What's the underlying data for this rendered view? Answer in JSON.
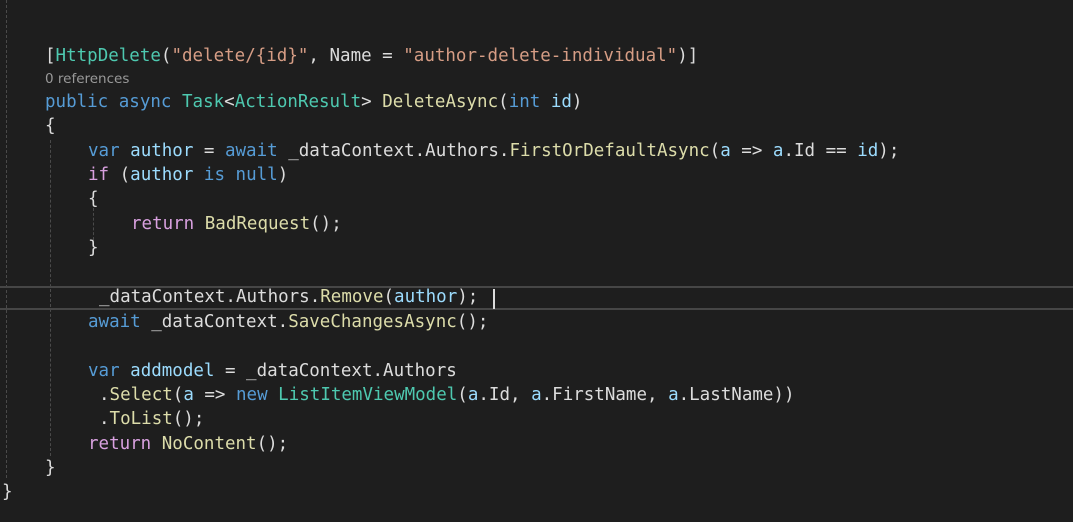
{
  "codelens": {
    "references": "0 references"
  },
  "code": {
    "l1": {
      "open": "[",
      "attr": "HttpDelete",
      "paren_open": "(",
      "route": "\"delete/{id}\"",
      "comma": ", Name = ",
      "name": "\"author-delete-individual\"",
      "close": ")]"
    },
    "l2": {
      "public": "public",
      "async": "async",
      "task": "Task",
      "lt": "<",
      "action_result": "ActionResult",
      "gt": ">",
      "method": "DeleteAsync",
      "p_open": "(",
      "int": "int",
      "id": "id",
      "p_close": ")"
    },
    "l3": {
      "brace": "{"
    },
    "l4": {
      "var": "var",
      "author": "author",
      "eq": " = ",
      "await": "await",
      "ctx": " _dataContext.Authors.",
      "method": "FirstOrDefaultAsync",
      "p_open": "(",
      "a1": "a",
      "arrow": " => ",
      "a2": "a",
      "member": ".Id == ",
      "id": "id",
      "end": ");"
    },
    "l5": {
      "if": "if",
      "p_open": " (",
      "author": "author",
      "is": "is",
      "null": "null",
      "p_close": ")"
    },
    "l6": {
      "brace": "{"
    },
    "l7": {
      "return": "return",
      "method": "BadRequest",
      "end": "();"
    },
    "l8": {
      "brace": "}"
    },
    "l9": {
      "ctx": "_dataContext.Authors.",
      "method": "Remove",
      "p_open": "(",
      "author": "author",
      "end": ");"
    },
    "l10": {
      "await": "await",
      "ctx": " _dataContext.",
      "method": "SaveChangesAsync",
      "end": "();"
    },
    "l11": {
      "var": "var",
      "name": "addmodel",
      "rest": " = _dataContext.Authors"
    },
    "l12": {
      "dot": ".",
      "method": "Select",
      "p_open": "(",
      "a1": "a",
      "arrow": " => ",
      "new": "new",
      "type": "ListItemViewModel",
      "p2_open": "(",
      "a2": "a",
      "m1": ".Id, ",
      "a3": "a",
      "m2": ".FirstName, ",
      "a4": "a",
      "m3": ".LastName))"
    },
    "l13": {
      "dot": ".",
      "method": "ToList",
      "end": "();"
    },
    "l14": {
      "return": "return",
      "method": "NoContent",
      "end": "();"
    },
    "l15": {
      "brace": "}"
    },
    "l16": {
      "brace": "}"
    }
  }
}
